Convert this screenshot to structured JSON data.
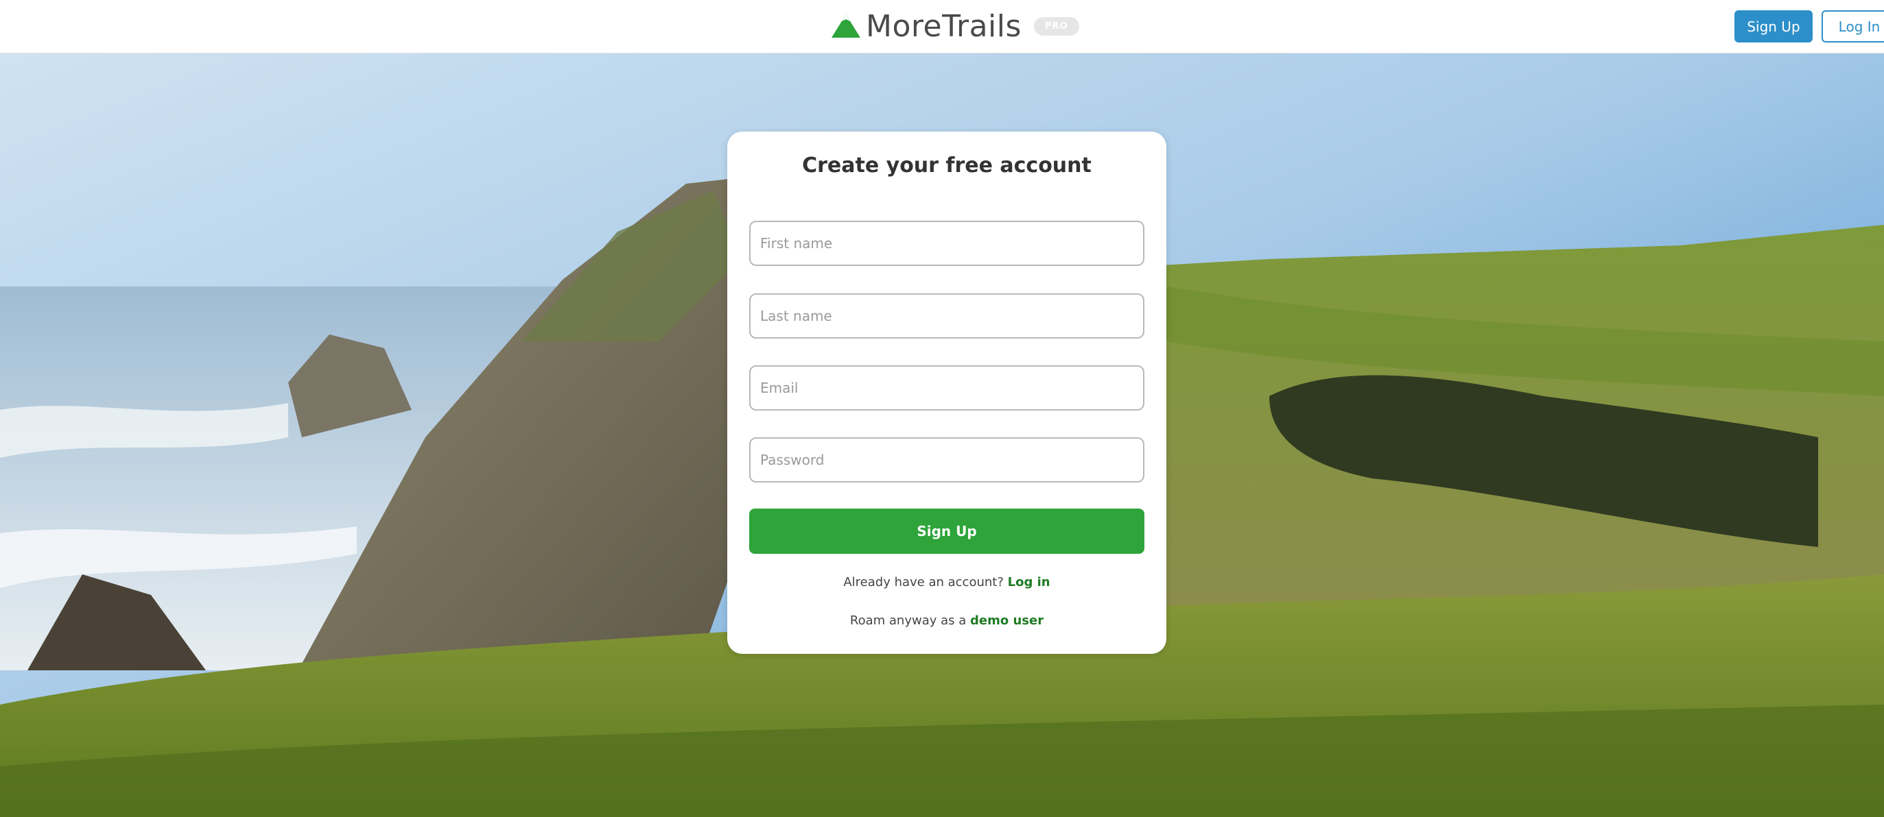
{
  "header": {
    "brand_name": "MoreTrails",
    "badge": "PRO",
    "logo_icon": "mountain-icon",
    "signup_label": "Sign Up",
    "login_label": "Log In"
  },
  "form": {
    "title": "Create your free account",
    "first_name_placeholder": "First name",
    "last_name_placeholder": "Last name",
    "email_placeholder": "Email",
    "password_placeholder": "Password",
    "submit_label": "Sign Up",
    "login_prompt": "Already have an account?",
    "login_link": "Log in",
    "demo_prompt": "Roam anyway as a",
    "demo_link": "demo user"
  },
  "colors": {
    "brand_green": "#2ea43a",
    "link_green": "#1f7a24",
    "header_blue": "#2d8fc9"
  }
}
